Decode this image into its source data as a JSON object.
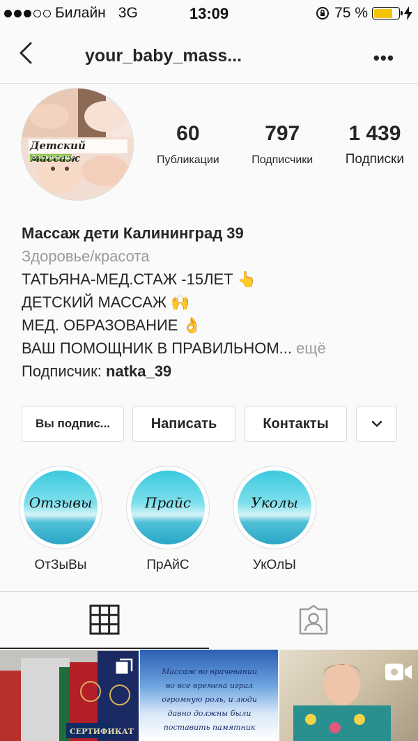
{
  "status_bar": {
    "carrier": "Билайн",
    "network": "3G",
    "time": "13:09",
    "battery_percent": "75 %",
    "battery_level": 0.75,
    "colors": {
      "battery_fill": "#f5c400"
    }
  },
  "header": {
    "username": "your_baby_mass...",
    "back_icon": "chevron-left-icon",
    "more_icon": "more-horizontal-icon",
    "more_label": "•••"
  },
  "profile": {
    "avatar_text": "Детский массаж",
    "avatar_subtext": "В Калининграде",
    "stats": [
      {
        "value": "60",
        "label": "Публикации"
      },
      {
        "value": "797",
        "label": "Подписчики"
      },
      {
        "value": "1 439",
        "label": "Подписки"
      }
    ]
  },
  "bio": {
    "name": "Массаж дети Калининград 39",
    "category": "Здоровье/красота",
    "lines": [
      "ТАТЬЯНА-МЕД.СТАЖ -15ЛЕТ 👆",
      "ДЕТСКИЙ МАССАЖ 🙌",
      "МЕД. ОБРАЗОВАНИЕ 👌",
      "ВАШ ПОМОЩНИК В ПРАВИЛЬНОМ..."
    ],
    "more_label": "ещё",
    "follower_prefix": "Подписчик:",
    "follower_name": "natka_39"
  },
  "actions": {
    "following": "Вы подпис...",
    "message": "Написать",
    "contacts": "Контакты",
    "dropdown_icon": "chevron-down-icon"
  },
  "highlights": [
    {
      "cover_text": "Отзывы",
      "label": "ОтЗыВы"
    },
    {
      "cover_text": "Прайс",
      "label": "ПрАйС"
    },
    {
      "cover_text": "Уколы",
      "label": "УкОлЫ"
    }
  ],
  "tabs": {
    "grid_icon": "grid-icon",
    "tagged_icon": "tagged-person-icon",
    "active": "grid"
  },
  "posts": [
    {
      "caption_text": "СЕРТИФИКАТ",
      "badge": "carousel-icon"
    },
    {
      "caption_text": "Массаж во врачевании во все времена играл огромную роль, и люди давно должны были поставить памятник ...",
      "badge": ""
    },
    {
      "caption_text": "",
      "badge": "video-icon"
    }
  ]
}
